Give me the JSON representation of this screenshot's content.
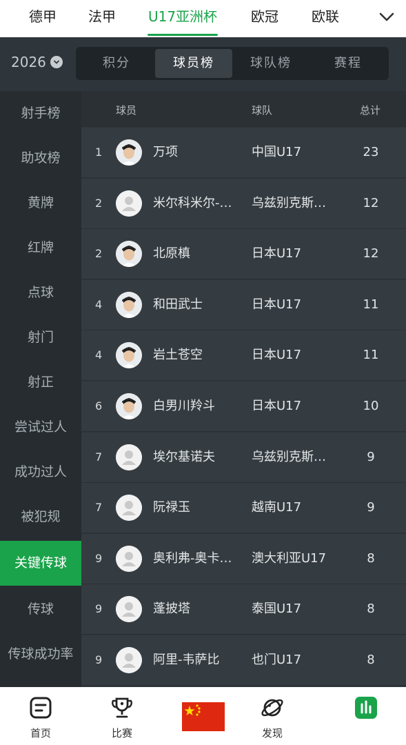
{
  "top_tabs": [
    "德甲",
    "法甲",
    "U17亚洲杯",
    "欧冠",
    "欧联"
  ],
  "active_top_tab": "U17亚洲杯",
  "season": "2026",
  "segments": [
    "积分",
    "球员榜",
    "球队榜",
    "赛程"
  ],
  "active_segment": "球员榜",
  "sidebar": [
    "射手榜",
    "助攻榜",
    "黄牌",
    "红牌",
    "点球",
    "射门",
    "射正",
    "尝试过人",
    "成功过人",
    "被犯规",
    "关键传球",
    "传球",
    "传球成功率"
  ],
  "active_sidebar": "关键传球",
  "table": {
    "headers": {
      "player": "球员",
      "team": "球队",
      "total": "总计"
    },
    "rows": [
      {
        "rank": "1",
        "name": "万项",
        "team": "中国U17",
        "total": "23",
        "photo": "player-photo"
      },
      {
        "rank": "2",
        "name": "米尔科米尔-…",
        "team": "乌兹别克斯…",
        "total": "12",
        "photo": "placeholder"
      },
      {
        "rank": "2",
        "name": "北原槙",
        "team": "日本U17",
        "total": "12",
        "photo": "player-photo"
      },
      {
        "rank": "4",
        "name": "和田武士",
        "team": "日本U17",
        "total": "11",
        "photo": "player-photo"
      },
      {
        "rank": "4",
        "name": "岩土苍空",
        "team": "日本U17",
        "total": "11",
        "photo": "player-photo"
      },
      {
        "rank": "6",
        "name": "白男川羚斗",
        "team": "日本U17",
        "total": "10",
        "photo": "player-photo"
      },
      {
        "rank": "7",
        "name": "埃尔基诺夫",
        "team": "乌兹别克斯…",
        "total": "9",
        "photo": "placeholder"
      },
      {
        "rank": "7",
        "name": "阮禄玉",
        "team": "越南U17",
        "total": "9",
        "photo": "placeholder"
      },
      {
        "rank": "9",
        "name": "奥利弗-奥卡…",
        "team": "澳大利亚U17",
        "total": "8",
        "photo": "placeholder"
      },
      {
        "rank": "9",
        "name": "蓬披塔",
        "team": "泰国U17",
        "total": "8",
        "photo": "placeholder"
      },
      {
        "rank": "9",
        "name": "阿里-韦萨比",
        "team": "也门U17",
        "total": "8",
        "photo": "placeholder"
      }
    ]
  },
  "bottom_nav": [
    {
      "label": "首页",
      "icon": "home-doc-icon"
    },
    {
      "label": "比赛",
      "icon": "trophy-icon"
    },
    {
      "label": "",
      "icon": "china-flag-icon"
    },
    {
      "label": "发现",
      "icon": "planet-icon"
    },
    {
      "label": "",
      "icon": "stats-bars-icon"
    }
  ],
  "colors": {
    "accent": "#1aa34a",
    "bg": "#2b3136",
    "flag_red": "#de2910",
    "flag_star": "#ffde00"
  }
}
